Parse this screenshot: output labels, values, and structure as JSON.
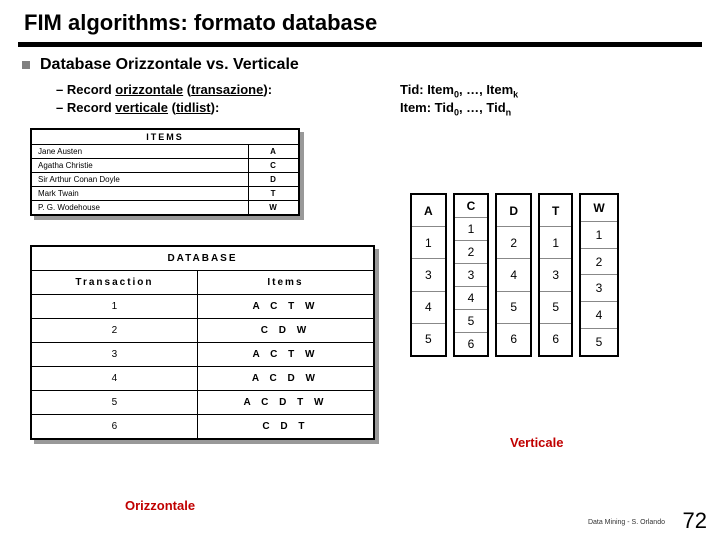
{
  "title": "FIM algorithms: formato database",
  "section": "Database Orizzontale vs. Verticale",
  "sub1_prefix": "– Record ",
  "sub1_und": "orizzontale",
  "sub1_paren_open": " (",
  "sub1_paren_und": "transazione",
  "sub1_paren_close": "):",
  "sub2_prefix": "– Record ",
  "sub2_und": "verticale",
  "sub2_paren_open": " (",
  "sub2_paren_und": "tidlist",
  "sub2_paren_close": "):",
  "rd1_pre": "Tid:   Item",
  "rd1_sub0": "0",
  "rd1_mid": ", …, Item",
  "rd1_subk": "k",
  "rd2_pre": "Item: Tid",
  "rd2_sub0": "0",
  "rd2_mid": ", …, Tid",
  "rd2_subn": "n",
  "items_header": "ITEMS",
  "items_rows": [
    {
      "name": "Jane Austen",
      "code": "A"
    },
    {
      "name": "Agatha Christie",
      "code": "C"
    },
    {
      "name": "Sir Arthur Conan Doyle",
      "code": "D"
    },
    {
      "name": "Mark Twain",
      "code": "T"
    },
    {
      "name": "P. G. Wodehouse",
      "code": "W"
    }
  ],
  "db_header": "DATABASE",
  "db_th1": "Transaction",
  "db_th2": "Items",
  "db_rows": [
    {
      "t": "1",
      "i": "A C T W"
    },
    {
      "t": "2",
      "i": "C D W"
    },
    {
      "t": "3",
      "i": "A C T W"
    },
    {
      "t": "4",
      "i": "A C D W"
    },
    {
      "t": "5",
      "i": "A C D T W"
    },
    {
      "t": "6",
      "i": "C D T"
    }
  ],
  "vert_columns": [
    {
      "h": "A",
      "vals": [
        "1",
        "3",
        "4",
        "5"
      ]
    },
    {
      "h": "C",
      "vals": [
        "1",
        "2",
        "3",
        "4",
        "5",
        "6"
      ]
    },
    {
      "h": "D",
      "vals": [
        "2",
        "4",
        "5",
        "6"
      ]
    },
    {
      "h": "T",
      "vals": [
        "1",
        "3",
        "5",
        "6"
      ]
    },
    {
      "h": "W",
      "vals": [
        "1",
        "2",
        "3",
        "4",
        "5"
      ]
    }
  ],
  "label_verticale": "Verticale",
  "label_orizzontale": "Orizzontale",
  "footer_credit": "Data Mining - S. Orlando",
  "page_num": "72"
}
